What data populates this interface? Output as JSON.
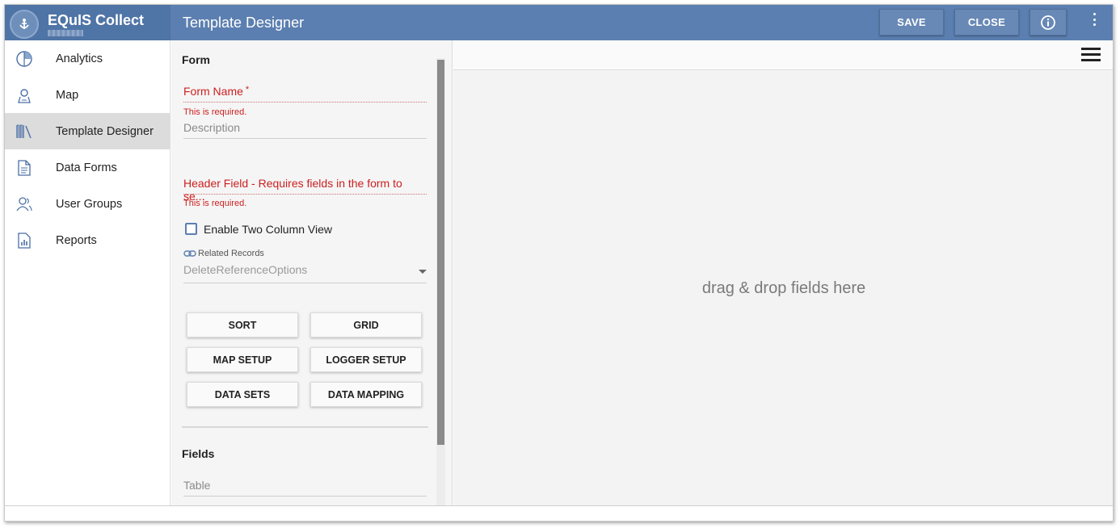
{
  "app": {
    "title": "EQuIS Collect",
    "page_title": "Template Designer"
  },
  "header": {
    "save_label": "SAVE",
    "close_label": "CLOSE",
    "info_icon": "info-icon",
    "more_icon": "more-vert-icon"
  },
  "sidebar": {
    "items": [
      {
        "label": "Analytics",
        "icon": "pie-chart-icon",
        "active": false
      },
      {
        "label": "Map",
        "icon": "map-pin-icon",
        "active": false
      },
      {
        "label": "Template Designer",
        "icon": "books-icon",
        "active": true
      },
      {
        "label": "Data Forms",
        "icon": "document-icon",
        "active": false
      },
      {
        "label": "User Groups",
        "icon": "users-icon",
        "active": false
      },
      {
        "label": "Reports",
        "icon": "report-icon",
        "active": false
      }
    ]
  },
  "form": {
    "section_title": "Form",
    "form_name_label": "Form Name",
    "form_name_required": "*",
    "required_msg": "This is required.",
    "description_label": "Description",
    "header_field_label": "Header Field - Requires fields in the form to se...",
    "header_required_msg": "This is required.",
    "two_column_label": "Enable Two Column View",
    "related_records_label": "Related Records",
    "related_records_value": "DeleteReferenceOptions",
    "buttons": [
      "SORT",
      "GRID",
      "MAP SETUP",
      "LOGGER SETUP",
      "DATA SETS",
      "DATA MAPPING"
    ],
    "fields_title": "Fields",
    "table_label": "Table"
  },
  "canvas": {
    "drop_text": "drag & drop fields here",
    "menu_icon": "hamburger-menu-icon"
  },
  "colors": {
    "header": "#5b7fb0",
    "error": "#cc1f1f",
    "active_nav": "#dcdcdc"
  }
}
